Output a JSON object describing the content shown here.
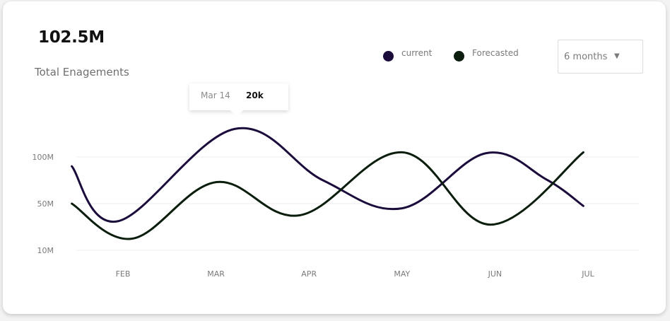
{
  "summary": {
    "total_value": "102.5M",
    "total_label": "Total Enagements"
  },
  "legend": [
    {
      "label": "current",
      "color": "#1b0c3b"
    },
    {
      "label": "Forecasted",
      "color": "#0b1d0d"
    }
  ],
  "range_select": {
    "selected": "6 months",
    "caret_icon": "caret-down-icon"
  },
  "tooltip": {
    "date": "Mar 14",
    "value": "20k"
  },
  "chart_data": {
    "type": "line",
    "categories": [
      "FEB",
      "MAR",
      "APR",
      "MAY",
      "JUN",
      "JUL"
    ],
    "y_ticks": [
      {
        "label": "100M",
        "value": 100
      },
      {
        "label": "50M",
        "value": 50
      },
      {
        "label": "10M",
        "value": 10
      }
    ],
    "grid": true,
    "legend_position": "top-right",
    "series": [
      {
        "name": "current",
        "color": "#1b0c3b",
        "points": [
          [
            0.45,
            90
          ],
          [
            0.95,
            35
          ],
          [
            2.2,
            130
          ],
          [
            3.15,
            75
          ],
          [
            4.0,
            46
          ],
          [
            4.9,
            104
          ],
          [
            5.55,
            76
          ],
          [
            5.95,
            48
          ]
        ]
      },
      {
        "name": "Forecasted",
        "color": "#0b1d0d",
        "points": [
          [
            0.45,
            50
          ],
          [
            1.1,
            20
          ],
          [
            2.0,
            73
          ],
          [
            2.9,
            40
          ],
          [
            4.0,
            105
          ],
          [
            4.95,
            32
          ],
          [
            5.95,
            105
          ]
        ]
      }
    ]
  }
}
